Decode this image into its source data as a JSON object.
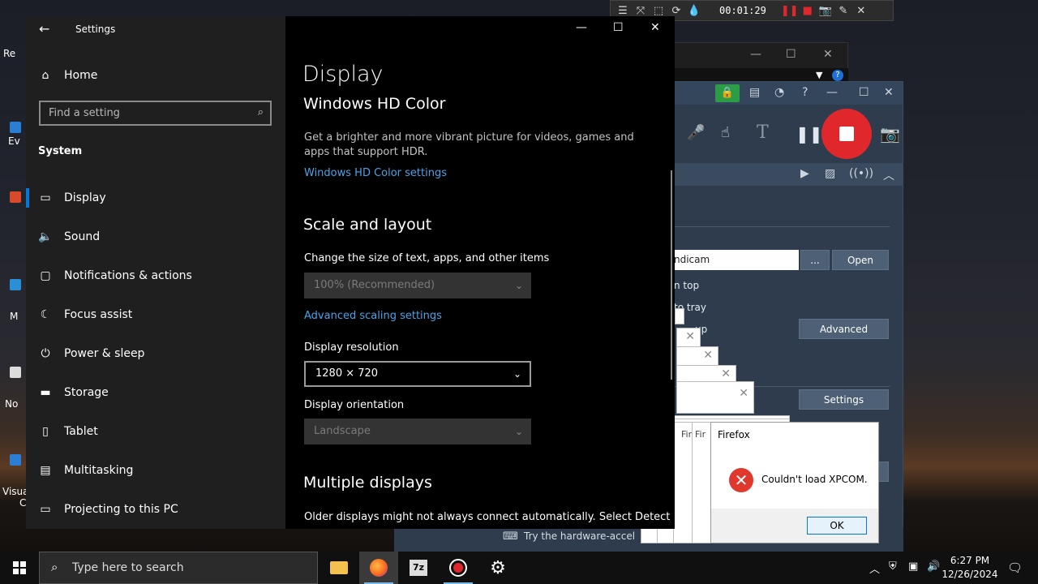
{
  "desktop": {
    "labels": [
      "Re",
      "Ev",
      "M",
      "No",
      "Visua",
      "C"
    ]
  },
  "recorder_toolbar": {
    "timer": "00:01:29"
  },
  "recorder": {
    "path_value": "ndicam",
    "browse_label": "...",
    "open_label": "Open",
    "advanced_label": "Advanced",
    "settings_label": "Settings",
    "opt_top": "n top",
    "opt_tray": "to tray",
    "opt_up": "up",
    "hint": "Try the hardware-accel",
    "accent_color": "#e0282c"
  },
  "popups": {
    "stack_label_1": "Fir",
    "stack_label_2": "Fir"
  },
  "firefox_dialog": {
    "title": "Firefox",
    "message": "Couldn't load XPCOM.",
    "ok_label": "OK"
  },
  "settings": {
    "app_title": "Settings",
    "home_label": "Home",
    "search_placeholder": "Find a setting",
    "section_label": "System",
    "nav": [
      {
        "label": "Display",
        "icon": "monitor-icon"
      },
      {
        "label": "Sound",
        "icon": "speaker-icon"
      },
      {
        "label": "Notifications & actions",
        "icon": "notification-icon"
      },
      {
        "label": "Focus assist",
        "icon": "moon-icon"
      },
      {
        "label": "Power & sleep",
        "icon": "power-icon"
      },
      {
        "label": "Storage",
        "icon": "storage-icon"
      },
      {
        "label": "Tablet",
        "icon": "tablet-icon"
      },
      {
        "label": "Multitasking",
        "icon": "multitasking-icon"
      },
      {
        "label": "Projecting to this PC",
        "icon": "projector-icon"
      }
    ],
    "page_title": "Display",
    "hd_color": {
      "title": "Windows HD Color",
      "description": "Get a brighter and more vibrant picture for videos, games and apps that support HDR.",
      "link": "Windows HD Color settings"
    },
    "scale": {
      "title": "Scale and layout",
      "change_size_label": "Change the size of text, apps, and other items",
      "scale_value": "100% (Recommended)",
      "advanced_link": "Advanced scaling settings",
      "resolution_label": "Display resolution",
      "resolution_value": "1280 × 720",
      "orientation_label": "Display orientation",
      "orientation_value": "Landscape"
    },
    "multiple": {
      "title": "Multiple displays",
      "description": "Older displays might not always connect automatically. Select Detect"
    },
    "accent_color": "#0078d7"
  },
  "taskbar": {
    "search_placeholder": "Type here to search",
    "time": "6:27 PM",
    "date": "12/26/2024"
  }
}
